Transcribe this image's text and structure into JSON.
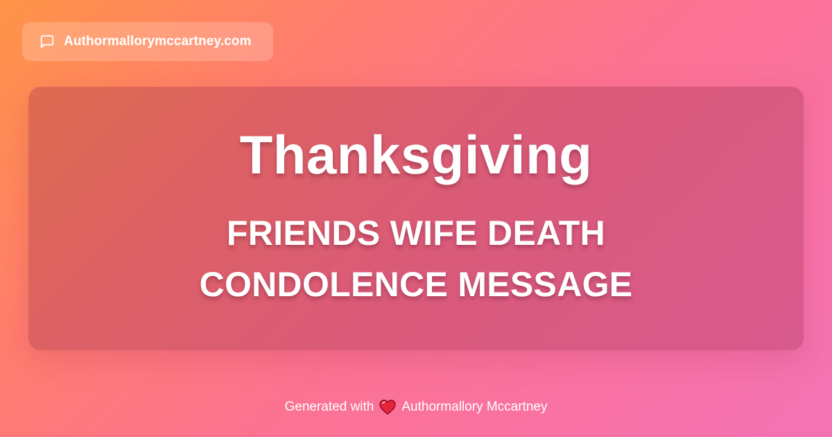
{
  "header": {
    "site_label": "Authormallorymccartney.com",
    "icon": "message-square-icon"
  },
  "card": {
    "title": "Thanksgiving",
    "subtitle_line1": "FRIENDS WIFE DEATH",
    "subtitle_line2": "CONDOLENCE MESSAGE"
  },
  "footer": {
    "prefix": "Generated with",
    "heart_icon": "heart-icon",
    "author": "Authormallory Mccartney"
  },
  "colors": {
    "gradient_start": "#ff9447",
    "gradient_end": "#f373b4",
    "heart": "#e5243b",
    "text": "#ffffff"
  }
}
